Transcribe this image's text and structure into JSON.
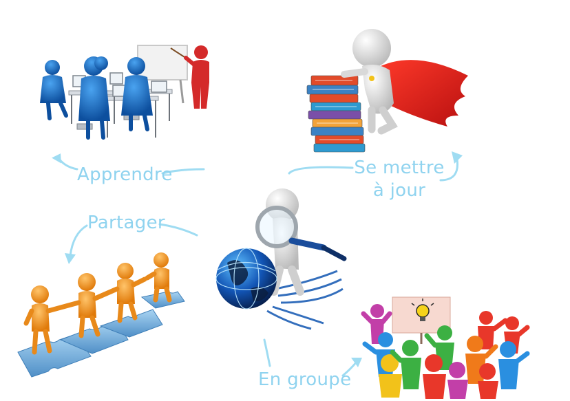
{
  "diagram": {
    "labels": {
      "apprendre": "Apprendre",
      "mettre_a_jour_line1": "Se mettre",
      "mettre_a_jour_line2": "à jour",
      "partager": "Partager",
      "en_groupe": "En groupe"
    },
    "colors": {
      "arrow": "#9fdcf2",
      "label": "#8fd3ef",
      "classroom_figures": "#1a6fc4",
      "teacher": "#d42a2a",
      "books": [
        "#e24b2a",
        "#3b82c4",
        "#f2a33a",
        "#7a4fa8",
        "#2e9ad0"
      ],
      "cape": "#d62020",
      "sharing_figures": "#f29a1a",
      "puzzle": "#7fb6e0",
      "group_figures": [
        "#e8372a",
        "#2a8fe0",
        "#3cb043",
        "#f2c21a",
        "#c23fa8",
        "#f07a1a"
      ]
    },
    "icons": [
      "classroom-illustration",
      "superhero-books-illustration",
      "globe-magnifier-illustration",
      "puzzle-sharing-illustration",
      "group-idea-illustration"
    ]
  }
}
